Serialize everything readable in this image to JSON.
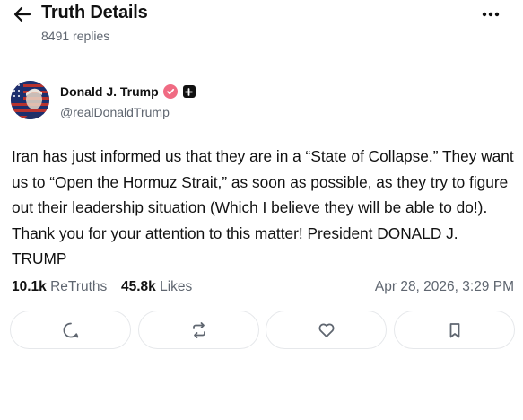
{
  "header": {
    "title": "Truth Details",
    "replies": "8491 replies"
  },
  "author": {
    "name": "Donald J. Trump",
    "handle": "@realDonaldTrump",
    "verified": true
  },
  "post": {
    "text": "Iran has just informed us that they are in a “State of Collapse.” They want us to “Open the Hormuz Strait,” as soon as possible, as they try to figure out their leadership situation (Which I believe they will be able to do!). Thank you for your attention to this matter! President DONALD J. TRUMP"
  },
  "stats": {
    "retruths_count": "10.1k",
    "retruths_label": "ReTruths",
    "likes_count": "45.8k",
    "likes_label": "Likes",
    "timestamp": "Apr 28, 2026, 3:29 PM"
  },
  "actions": [
    "reply-icon",
    "retruth-icon",
    "like-icon",
    "bookmark-icon"
  ],
  "colors": {
    "verified_badge": "#f06b83",
    "muted_text": "#5f6670",
    "button_border": "#e6e8eb"
  }
}
